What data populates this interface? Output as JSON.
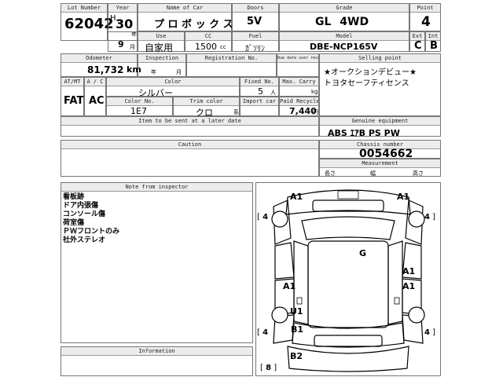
{
  "top": {
    "lot_number": {
      "label": "Lot Number",
      "value": "62042"
    },
    "year": {
      "label": "Year",
      "era": "H",
      "value": "30",
      "suffix": "年"
    },
    "month": {
      "value": "9",
      "suffix": "月"
    },
    "name_of_car": {
      "label": "Name of Car",
      "value": "プ ロ ボ ッ ク ス"
    },
    "doors": {
      "label": "Doors",
      "value": "5V"
    },
    "grade": {
      "label": "Grade",
      "value": "GL 4WD"
    },
    "point": {
      "label": "Point",
      "value": "4"
    },
    "use": {
      "label": "Use",
      "value": "自家用"
    },
    "cc": {
      "label": "CC",
      "value": "1500",
      "unit": "cc"
    },
    "fuel": {
      "label": "Fuel",
      "value": "ｶﾞｿﾘﾝ"
    },
    "model": {
      "label": "Model",
      "value": "DBE-NCP165V"
    },
    "ext": {
      "label": "Ext",
      "value": "C"
    },
    "int": {
      "label": "Int",
      "value": "B"
    }
  },
  "mid": {
    "odometer": {
      "label": "Odometer",
      "value": "81,732",
      "unit": "km"
    },
    "inspection": {
      "label": "Inspection",
      "year_unit": "年",
      "month_unit": "月"
    },
    "registration": {
      "label": "Registration No."
    },
    "due_date": {
      "label": "Due date user receive"
    },
    "selling_point": {
      "label": "Selling point",
      "lines": [
        "★オークションデビュー★",
        "トヨタセーフティセンス"
      ]
    },
    "at_mt": {
      "label": "AT/MT",
      "value": "FAT"
    },
    "ac": {
      "label": "A / C",
      "value": "AC"
    },
    "color": {
      "label": "Color",
      "value": "シルバー"
    },
    "fixed_no": {
      "label": "Fixed No.",
      "value": "5",
      "unit": "人"
    },
    "max_carry": {
      "label": "Max. Carry",
      "unit": "kg"
    },
    "color_no": {
      "label": "Color No.",
      "value": "1E7"
    },
    "trim_color": {
      "label": "Trim color",
      "value": "クロ",
      "unit": "系"
    },
    "import_car": {
      "label": "Import car"
    },
    "paid_recycle": {
      "label": "Paid Recycle",
      "value": "7,440",
      "unit": "円"
    },
    "items_later": {
      "label": "Item to be sent at a later date"
    },
    "genuine_equipment": {
      "label": "Genuine equipment",
      "value": "ABS ｴｱB PS PW"
    },
    "caution": {
      "label": "Caution"
    },
    "chassis_number": {
      "label": "Chassis number",
      "value": "0054662"
    },
    "measurement": {
      "label": "Measurement",
      "length": "長さ",
      "width": "幅",
      "height": "高さ"
    }
  },
  "bottom": {
    "note": {
      "label": "Note from inspector",
      "lines": [
        "看板跡",
        "ドア内張傷",
        "コンソール傷",
        "荷室傷",
        "ＰＷフロントのみ",
        "社外ステレオ"
      ]
    },
    "information": {
      "label": "Information"
    }
  },
  "diagram": {
    "marks": {
      "a1_tl": "A1",
      "a1_tr": "A1",
      "g": "G",
      "a1_ml": "A1",
      "a1_mr": "A1",
      "a1_rr": "A1",
      "u1": "U1",
      "b1": "B1",
      "b2": "B2"
    },
    "tires": {
      "fl": "4",
      "fr": "4",
      "rl": "4",
      "rr": "4",
      "spare": "8"
    }
  }
}
